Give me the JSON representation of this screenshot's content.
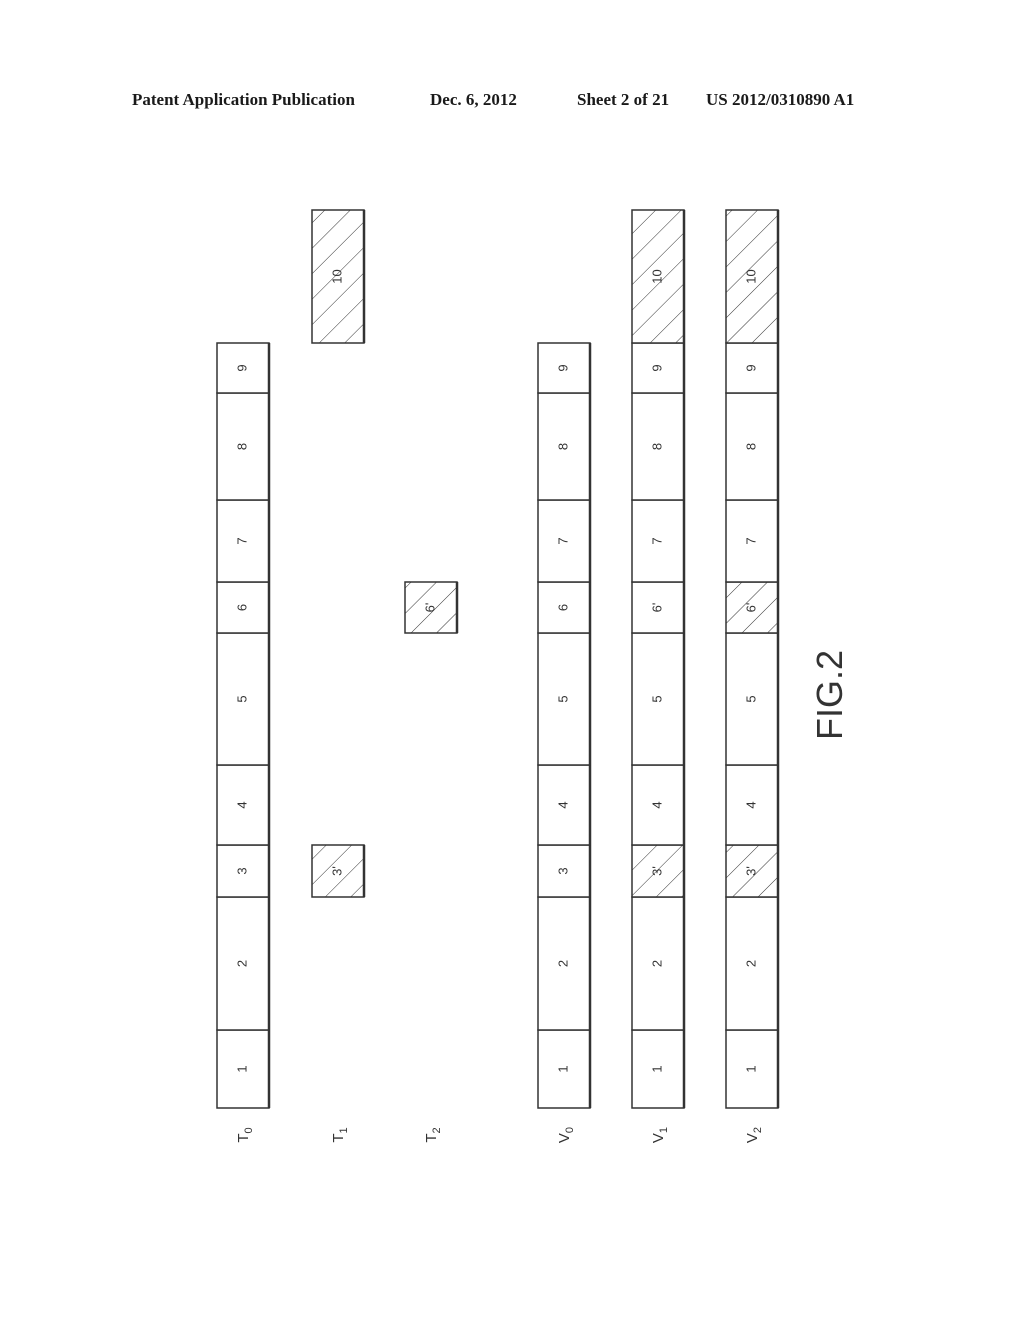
{
  "header": {
    "publication": "Patent Application Publication",
    "date": "Dec. 6, 2012",
    "sheet": "Sheet 2 of 21",
    "number": "US 2012/0310890 A1"
  },
  "figure": {
    "label": "FIG.2",
    "rows": [
      {
        "id": "T0",
        "label_main": "T",
        "label_sub": "0",
        "segments": [
          {
            "label": "1",
            "slot": 1,
            "hatched": false
          },
          {
            "label": "2",
            "slot": 2,
            "hatched": false
          },
          {
            "label": "3",
            "slot": 3,
            "hatched": false
          },
          {
            "label": "4",
            "slot": 4,
            "hatched": false
          },
          {
            "label": "5",
            "slot": 5,
            "hatched": false
          },
          {
            "label": "6",
            "slot": 6,
            "hatched": false
          },
          {
            "label": "7",
            "slot": 7,
            "hatched": false
          },
          {
            "label": "8",
            "slot": 8,
            "hatched": false
          },
          {
            "label": "9",
            "slot": 9,
            "hatched": false
          }
        ]
      },
      {
        "id": "T1",
        "label_main": "T",
        "label_sub": "1",
        "segments": [
          {
            "label": "3'",
            "slot": 3,
            "hatched": true
          },
          {
            "label": "10",
            "slot": 10,
            "hatched": true
          }
        ]
      },
      {
        "id": "T2",
        "label_main": "T",
        "label_sub": "2",
        "segments": [
          {
            "label": "6'",
            "slot": 6,
            "hatched": true
          }
        ]
      },
      {
        "id": "V0",
        "label_main": "V",
        "label_sub": "0",
        "segments": [
          {
            "label": "1",
            "slot": 1,
            "hatched": false
          },
          {
            "label": "2",
            "slot": 2,
            "hatched": false
          },
          {
            "label": "3",
            "slot": 3,
            "hatched": false
          },
          {
            "label": "4",
            "slot": 4,
            "hatched": false
          },
          {
            "label": "5",
            "slot": 5,
            "hatched": false
          },
          {
            "label": "6",
            "slot": 6,
            "hatched": false
          },
          {
            "label": "7",
            "slot": 7,
            "hatched": false
          },
          {
            "label": "8",
            "slot": 8,
            "hatched": false
          },
          {
            "label": "9",
            "slot": 9,
            "hatched": false
          }
        ]
      },
      {
        "id": "V1",
        "label_main": "V",
        "label_sub": "1",
        "segments": [
          {
            "label": "1",
            "slot": 1,
            "hatched": false
          },
          {
            "label": "2",
            "slot": 2,
            "hatched": false
          },
          {
            "label": "3'",
            "slot": 3,
            "hatched": true
          },
          {
            "label": "4",
            "slot": 4,
            "hatched": false
          },
          {
            "label": "5",
            "slot": 5,
            "hatched": false
          },
          {
            "label": "6'",
            "slot": 6,
            "hatched": false
          },
          {
            "label": "7",
            "slot": 7,
            "hatched": false
          },
          {
            "label": "8",
            "slot": 8,
            "hatched": false
          },
          {
            "label": "9",
            "slot": 9,
            "hatched": false
          },
          {
            "label": "10",
            "slot": 10,
            "hatched": true
          }
        ]
      },
      {
        "id": "V2",
        "label_main": "V",
        "label_sub": "2",
        "segments": [
          {
            "label": "1",
            "slot": 1,
            "hatched": false
          },
          {
            "label": "2",
            "slot": 2,
            "hatched": false
          },
          {
            "label": "3'",
            "slot": 3,
            "hatched": true
          },
          {
            "label": "4",
            "slot": 4,
            "hatched": false
          },
          {
            "label": "5",
            "slot": 5,
            "hatched": false
          },
          {
            "label": "6'",
            "slot": 6,
            "hatched": true
          },
          {
            "label": "7",
            "slot": 7,
            "hatched": false
          },
          {
            "label": "8",
            "slot": 8,
            "hatched": false
          },
          {
            "label": "9",
            "slot": 9,
            "hatched": false
          },
          {
            "label": "10",
            "slot": 10,
            "hatched": true
          }
        ]
      }
    ]
  }
}
